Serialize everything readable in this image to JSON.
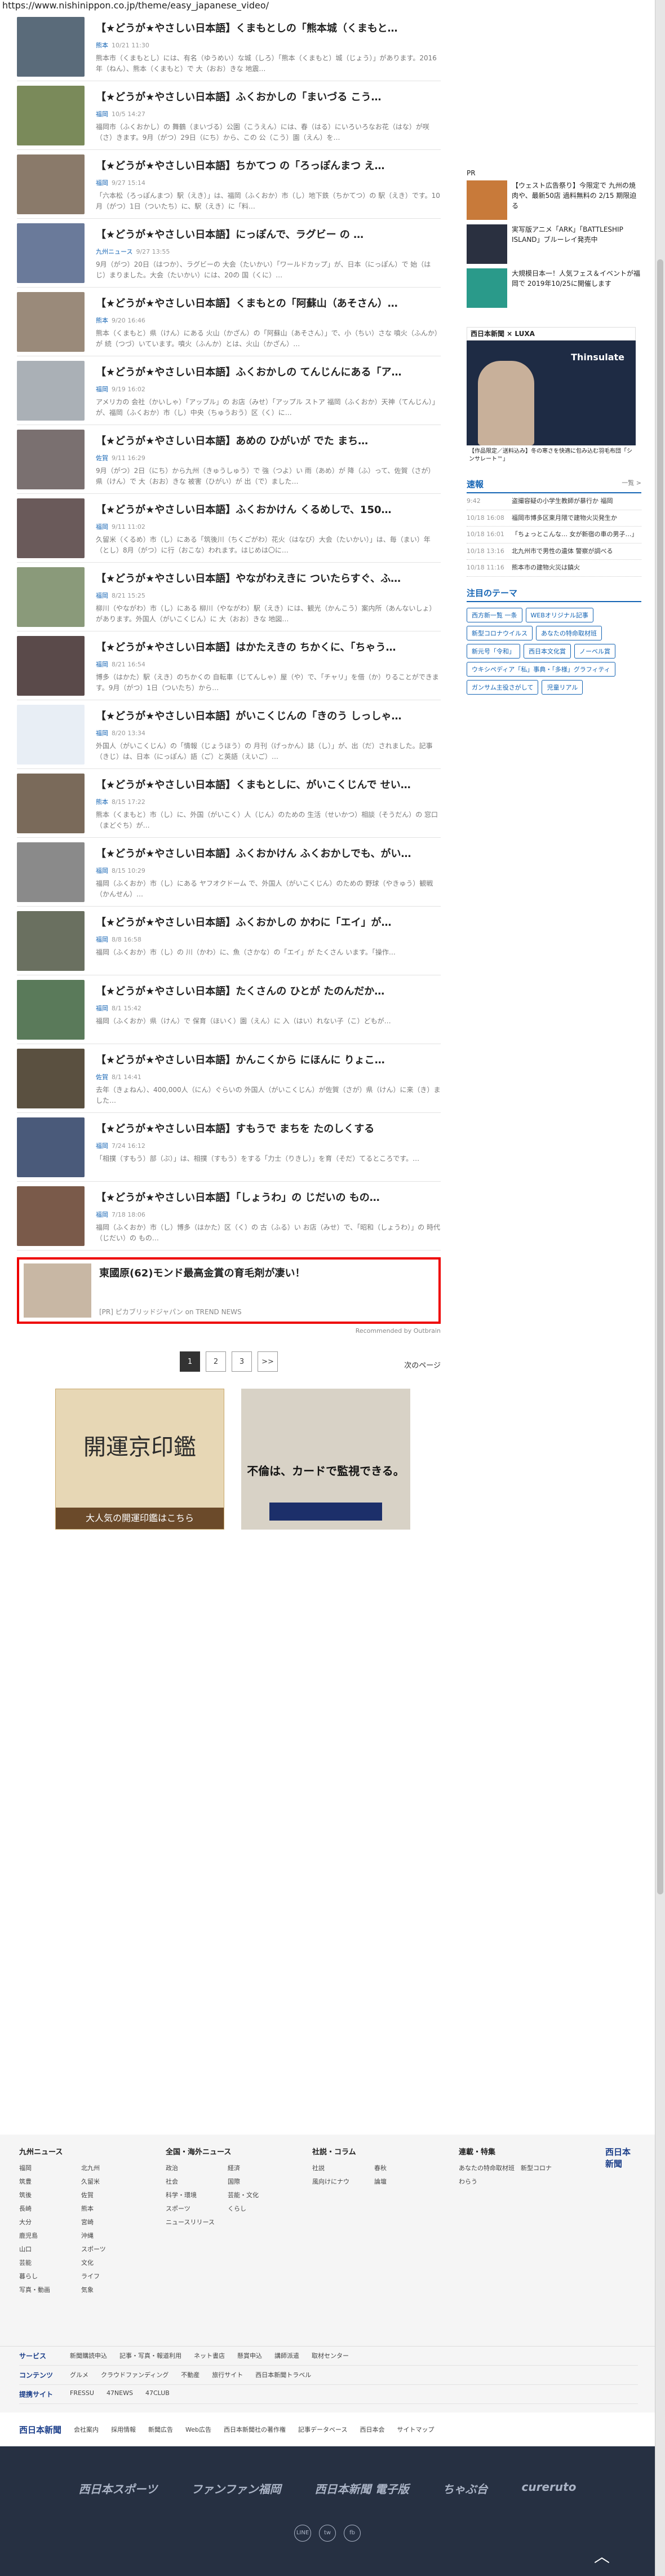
{
  "url": "https://www.nishinippon.co.jp/theme/easy_japanese_video/",
  "articles": [
    {
      "title": "【★どうが★やさしい日本語】くまもとしの「熊本城（くまもと…",
      "cat": "熊本",
      "date": "10/21 11:30",
      "snip": "熊本市（くまもとし）には、有名（ゆうめい）な城（しろ）「熊本（くまもと）城（じょう）」があります。2016年（ねん）、熊本（くまもと）で 大（おお）きな 地震…",
      "color": "#5a6b7a"
    },
    {
      "title": "【★どうが★やさしい日本語】ふくおかしの「まいづる こう…",
      "cat": "福岡",
      "date": "10/5 14:27",
      "snip": "福岡市（ふくおかし）の 舞鶴（まいづる）公園（こうえん）には、春（はる）にいろいろなお花（はな）が咲（さ）きます。9月（がつ）29日（にち）から、この 公（こう）園（えん）を…",
      "color": "#7a8a5a"
    },
    {
      "title": "【★どうが★やさしい日本語】ちかてつ の「ろっぽんまつ え…",
      "cat": "福岡",
      "date": "9/27 15:14",
      "snip": "「六本松（ろっぽんまつ）駅（えき）」は、福岡（ふくおか）市（し）地下鉄（ちかてつ）の 駅（えき）です。10月（がつ）1日（ついたち）に、駅（えき）に「料…",
      "color": "#8a7a6a"
    },
    {
      "title": "【★どうが★やさしい日本語】にっぽんで、ラグビー の …",
      "cat": "九州ニュース",
      "date": "9/27 13:55",
      "snip": "9月（がつ）20日（はつか）、ラグビーの 大会（たいかい）「ワールドカップ」が、日本（にっぽん）で 始（はじ）まりました。大会（たいかい）には、20の 国（くに）…",
      "color": "#6a7a9a"
    },
    {
      "title": "【★どうが★やさしい日本語】くまもとの「阿蘇山（あそさん）…",
      "cat": "熊本",
      "date": "9/20 16:46",
      "snip": "熊本（くまもと）県（けん）にある 火山（かざん）の「阿蘇山（あそさん）」で、小（ちい）さな 噴火（ふんか）が 続（つづ）いています。噴火（ふんか）とは、火山（かざん）…",
      "color": "#9a8a7a"
    },
    {
      "title": "【★どうが★やさしい日本語】ふくおかしの てんじんにある「ア…",
      "cat": "福岡",
      "date": "9/19 16:02",
      "snip": "アメリカの 会社（かいしゃ）「アップル」の お店（みせ）「アップル ストア 福岡（ふくおか）天神（てんじん）」が、福岡（ふくおか）市（し）中央（ちゅうおう）区（く）に…",
      "color": "#aab0b6"
    },
    {
      "title": "【★どうが★やさしい日本語】あめの ひがいが でた まち…",
      "cat": "佐賀",
      "date": "9/11 16:29",
      "snip": "9月（がつ）2日（にち）から九州（きゅうしゅう）で 強（つよ）い 雨（あめ）が 降（ふ）って、佐賀（さが）県（けん）で 大（おお）きな 被害（ひがい）が 出（で）ました…",
      "color": "#7a7070"
    },
    {
      "title": "【★どうが★やさしい日本語】ふくおかけん くるめしで、150…",
      "cat": "福岡",
      "date": "9/11 11:02",
      "snip": "久留米（くるめ）市（し）にある「筑後川（ちくごがわ）花火（はなび）大会（たいかい）」は、毎（まい）年（とし）8月（がつ）に行（おこな）われます。はじめは〇に…",
      "color": "#6a5a5a"
    },
    {
      "title": "【★どうが★やさしい日本語】やながわえきに ついたらすぐ、ふ…",
      "cat": "福岡",
      "date": "8/21 15:25",
      "snip": "柳川（やながわ）市（し）にある 柳川（やながわ）駅（えき）には、観光（かんこう）案内所（あんないしょ）があります。外国人（がいこくじん）に 大（おお）きな 地図…",
      "color": "#8a9a7a"
    },
    {
      "title": "【★どうが★やさしい日本語】はかたえきの ちかくに、「ちゃう…",
      "cat": "福岡",
      "date": "8/21 16:54",
      "snip": "博多（はかた）駅（えき）のちかくの 自転車（じてんしゃ）屋（や）で、「チャリ」を借（か）りることができます。9月（がつ）1日（ついたち）から…",
      "color": "#5a4a4a"
    },
    {
      "title": "【★どうが★やさしい日本語】がいこくじんの「きのう しっしゃ…",
      "cat": "福岡",
      "date": "8/20 13:34",
      "snip": "外国人（がいこくじん）の「情報（じょうほう）の 月刊（げっかん）誌（し）」が、出（だ）されました。記事（きじ）は、日本（にっぽん）語（ご）と英語（えいご）…",
      "color": "#e8eef5"
    },
    {
      "title": "【★どうが★やさしい日本語】くまもとしに、がいこくじんで せい…",
      "cat": "熊本",
      "date": "8/15 17:22",
      "snip": "熊本（くまもと）市（し）に、外国（がいこく）人（じん）のための 生活（せいかつ）相談（そうだん）の 窓口（まどぐち）が…",
      "color": "#7a6a5a"
    },
    {
      "title": "【★どうが★やさしい日本語】ふくおかけん ふくおかしでも、がい…",
      "cat": "福岡",
      "date": "8/15 10:29",
      "snip": "福岡（ふくおか）市（し）にある ヤフオクドーム で、外国人（がいこくじん）のための 野球（やきゅう）観戦（かんせん）…",
      "color": "#8a8a8a"
    },
    {
      "title": "【★どうが★やさしい日本語】ふくおかしの かわに「エイ」が…",
      "cat": "福岡",
      "date": "8/8 16:58",
      "snip": "福岡（ふくおか）市（し）の 川（かわ）に、魚（さかな）の「エイ」が たくさん います。「操作…",
      "color": "#6a7060"
    },
    {
      "title": "【★どうが★やさしい日本語】たくさんの ひとが たのんだか…",
      "cat": "福岡",
      "date": "8/1 15:42",
      "snip": "福岡（ふくおか）県（けん）で 保育（ほいく）園（えん）に 入（はい）れない子（こ）どもが…",
      "color": "#5a7a5a"
    },
    {
      "title": "【★どうが★やさしい日本語】かんこくから にほんに りょこ…",
      "cat": "佐賀",
      "date": "8/1 14:41",
      "snip": "去年（きょねん）、400,000人（にん）ぐらいの 外国人（がいこくじん）が佐賀（さが）県（けん）に来（き）ました…",
      "color": "#5a5040"
    },
    {
      "title": "【★どうが★やさしい日本語】すもうで まちを たのしくする",
      "cat": "福岡",
      "date": "7/24 16:12",
      "snip": "「相撲（すもう）部（ぶ）」は、相撲（すもう）をする「力士（りきし）」を育（そだ）てるところです。…",
      "color": "#4a5a7a"
    },
    {
      "title": "【★どうが★やさしい日本語】「しょうわ」の じだいの もの…",
      "cat": "福岡",
      "date": "7/18 18:06",
      "snip": "福岡（ふくおか）市（し）博多（はかた）区（く）の 古（ふる）い お店（みせ）で、「昭和（しょうわ）」の 時代（じだい）の もの…",
      "color": "#7a5a4a"
    }
  ],
  "ad": {
    "title": "東國原(62)モンド最高金賞の育毛剤が凄い！",
    "sponsor": "[PR] ピカブリッドジャパン on TREND NEWS",
    "outbrain": "Recommended by Outbrain"
  },
  "pager": {
    "pages": [
      "1",
      "2",
      "3",
      ">>"
    ],
    "next": "次のページ"
  },
  "banners": {
    "b1": "開運京印鑑",
    "b1sub": "大人気の開運印鑑はこちら",
    "b2": "不倫は、カードで監視できる。"
  },
  "sidebar": {
    "pr": "PR",
    "items": [
      {
        "t": "【ウェスト広告祭り】今限定で 九州の焼肉や、最新50店 過料無料の 2/15 期限迫る"
      },
      {
        "t": "実写版アニメ「ARK」「BATTLESHIP ISLAND」ブルーレイ発売中"
      },
      {
        "t": "大規模日本一！人気フェス＆イベントが福岡で 2019年10/25に開催します"
      }
    ],
    "luxa": "西日本新聞 × LUXA",
    "luxaProd": "Thinsulate",
    "luxaCap": "【作品限定／送料込み】冬の寒さを快適に包み込む羽毛布団「シンサレート™」",
    "news_title": "速報",
    "news_more": "一覧 >",
    "news": [
      {
        "d": "9:42",
        "t": "盗撮容疑の小学生教師が暴行か 福岡"
      },
      {
        "d": "10/18 16:08",
        "t": "福岡市博多区東月隈で建物火災発生か"
      },
      {
        "d": "10/18 16:01",
        "t": "「ちょっとこんな… 女が新宿の車の男子…」"
      },
      {
        "d": "10/18 13:16",
        "t": "北九州市で男性の遺体 警察が調べる"
      },
      {
        "d": "10/18 11:16",
        "t": "熊本市の建物火災は鎮火"
      }
    ],
    "tags_title": "注目のテーマ",
    "tags": [
      "西方新一覧 一条",
      "WEBオリジナル記事",
      "新型コロナウイルス",
      "あなたの特命取材班",
      "新元号「令和」",
      "西日本文化賞",
      "ノーベル賞",
      "ウキシペディア「私」事典・「多様」グラフィティ",
      "ガンサム主役さがして",
      "児童リアル"
    ]
  },
  "footer": {
    "cols": [
      {
        "h": "九州ニュース",
        "l": [
          "福岡",
          "北九州",
          "筑豊",
          "久留米",
          "筑後",
          "佐賀",
          "長崎",
          "熊本",
          "大分",
          "宮崎",
          "鹿児島",
          "沖縄",
          "山口",
          "スポーツ",
          "芸能",
          "文化",
          "暮らし",
          "ライフ",
          "写真・動画",
          "気象"
        ]
      },
      {
        "h": "全国・海外ニュース",
        "l": [
          "政治",
          "経済",
          "社会",
          "国際",
          "科学・環境",
          "芸能・文化",
          "スポーツ",
          "くらし",
          "ニュースリリース"
        ]
      },
      {
        "h": "社説・コラム",
        "l": [
          "社説",
          "春秋",
          "風向けにナウ",
          "論壇"
        ]
      },
      {
        "h": "連載・特集",
        "l": [
          "あなたの特命取材班",
          "新型コロナ",
          "わらう"
        ]
      }
    ],
    "logo": "西日本新聞",
    "services": [
      {
        "h": "サービス",
        "l": [
          "新聞購読申込",
          "記事・写真・報道利用",
          "ネット書店",
          "懸賞申込",
          "講師派遣",
          "取材センター"
        ]
      },
      {
        "h": "コンテンツ",
        "l": [
          "グルメ",
          "クラウドファンディング",
          "不動産",
          "旅行サイト",
          "西日本新聞トラベル"
        ]
      },
      {
        "h": "提携サイト",
        "l": [
          "FRESSU",
          "47NEWS",
          "47CLUB"
        ]
      }
    ],
    "bottom": [
      "会社案内",
      "採用情報",
      "新聞広告",
      "Web広告",
      "西日本新聞社の著作権",
      "記事データベース",
      "西日本会",
      "サイトマップ"
    ],
    "brands": [
      "西日本スポーツ",
      "ファンファン福岡",
      "西日本新聞 電子版",
      "ちゃぶ台",
      "cureruto"
    ],
    "social": [
      "LINE",
      "tw",
      "fb"
    ]
  }
}
